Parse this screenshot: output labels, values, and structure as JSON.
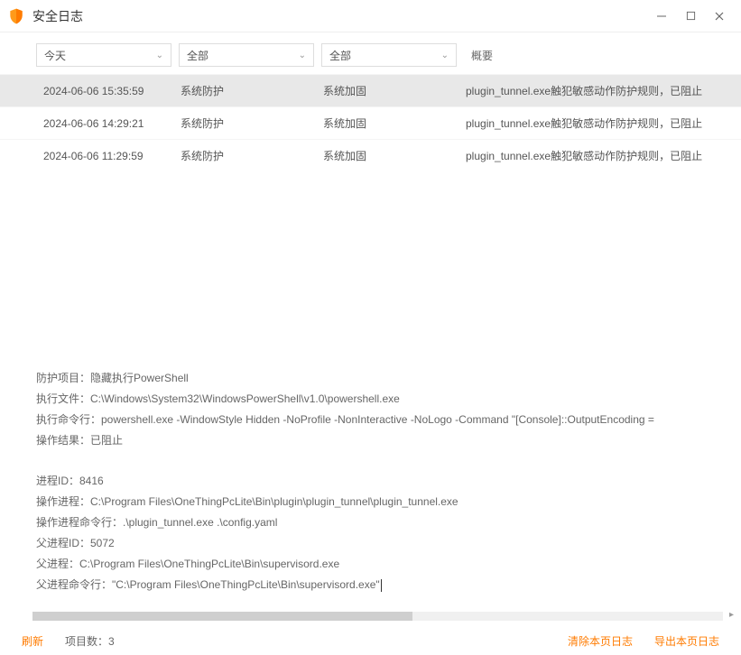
{
  "window": {
    "title": "安全日志"
  },
  "filters": {
    "date": "今天",
    "category": "全部",
    "subcategory": "全部",
    "summary_label": "概要"
  },
  "rows": [
    {
      "time": "2024-06-06 15:35:59",
      "cat": "系统防护",
      "sub": "系统加固",
      "summary": "plugin_tunnel.exe触犯敏感动作防护规则，已阻止"
    },
    {
      "time": "2024-06-06 14:29:21",
      "cat": "系统防护",
      "sub": "系统加固",
      "summary": "plugin_tunnel.exe触犯敏感动作防护规则，已阻止"
    },
    {
      "time": "2024-06-06 11:29:59",
      "cat": "系统防护",
      "sub": "系统加固",
      "summary": "plugin_tunnel.exe触犯敏感动作防护规则，已阻止"
    }
  ],
  "detail": {
    "l1": "防护项目：隐藏执行PowerShell",
    "l2": "执行文件：C:\\Windows\\System32\\WindowsPowerShell\\v1.0\\powershell.exe",
    "l3": "执行命令行：powershell.exe -WindowStyle Hidden -NoProfile -NonInteractive -NoLogo -Command \"[Console]::OutputEncoding = ",
    "l4": "操作结果：已阻止",
    "l5": "进程ID：8416",
    "l6": "操作进程：C:\\Program Files\\OneThingPcLite\\Bin\\plugin\\plugin_tunnel\\plugin_tunnel.exe",
    "l7": "操作进程命令行：.\\plugin_tunnel.exe .\\config.yaml",
    "l8": "父进程ID：5072",
    "l9": "父进程：C:\\Program Files\\OneThingPcLite\\Bin\\supervisord.exe",
    "l10": "父进程命令行：\"C:\\Program Files\\OneThingPcLite\\Bin\\supervisord.exe\""
  },
  "footer": {
    "refresh": "刷新",
    "count_label": "项目数：3",
    "clear": "清除本页日志",
    "export": "导出本页日志"
  }
}
